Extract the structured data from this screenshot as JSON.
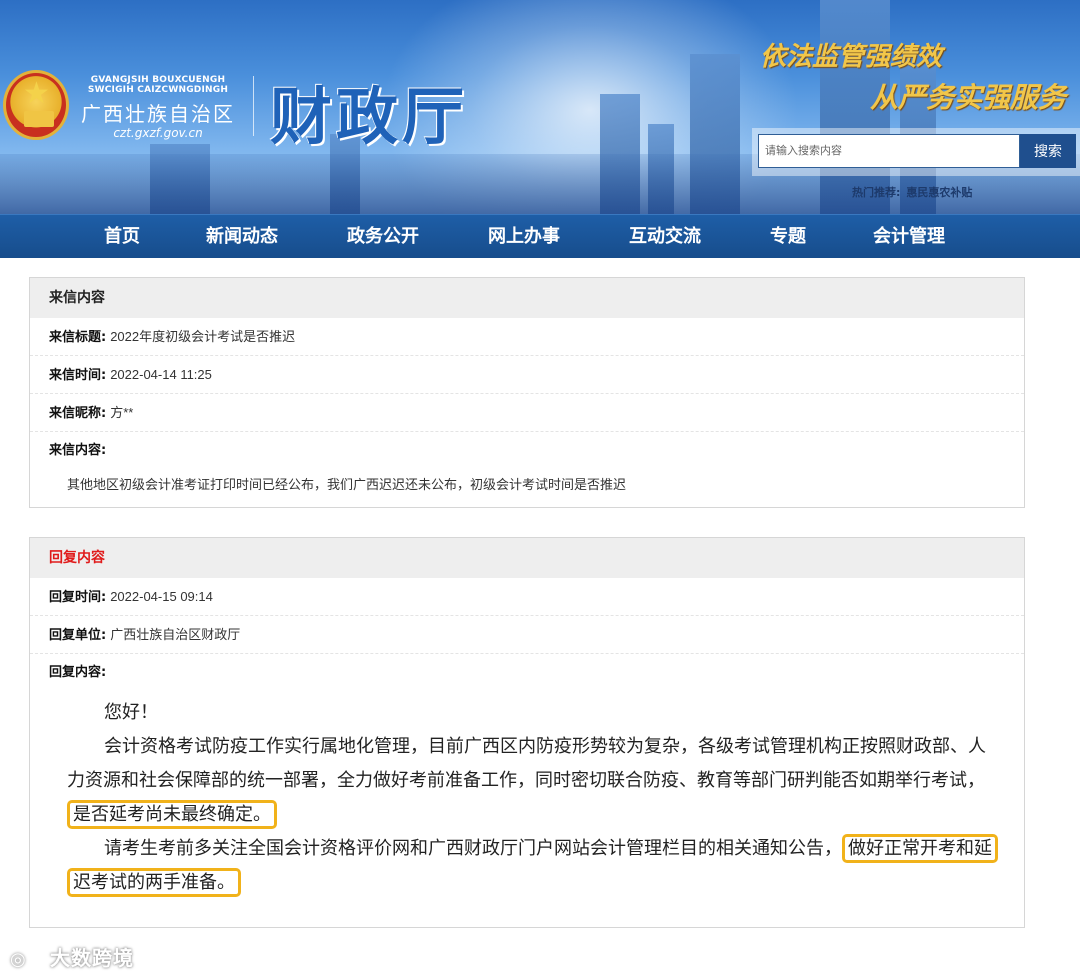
{
  "header": {
    "org_latin": "GVANGJSIH BOUXCUENGH SWCIGIH CAIZCWNGDINGH",
    "org_name": "广西壮族自治区",
    "org_domain": "czt.gxzf.gov.cn",
    "site_title": "财政厅",
    "slogan_1": "依法监管强绩效",
    "slogan_2": "从严务实强服务",
    "search_placeholder": "请输入搜索内容",
    "search_button": "搜索",
    "hot_label": "热门推荐:",
    "hot_link": "惠民惠农补贴"
  },
  "nav": [
    "首页",
    "新闻动态",
    "政务公开",
    "网上办事",
    "互动交流",
    "专题",
    "会计管理"
  ],
  "letter": {
    "section_title": "来信内容",
    "title_label": "来信标题:",
    "title_value": "2022年度初级会计考试是否推迟",
    "time_label": "来信时间:",
    "time_value": "2022-04-14 11:25",
    "nick_label": "来信昵称:",
    "nick_value": "方**",
    "content_label": "来信内容:",
    "content_value": "其他地区初级会计准考证打印时间已经公布，我们广西迟迟还未公布，初级会计考试时间是否推迟"
  },
  "reply": {
    "section_title": "回复内容",
    "time_label": "回复时间:",
    "time_value": "2022-04-15 09:14",
    "unit_label": "回复单位:",
    "unit_value": "广西壮族自治区财政厅",
    "content_label": "回复内容:",
    "greeting": "您好！",
    "para1_text": "会计资格考试防疫工作实行属地化管理，目前广西区内防疫形势较为复杂，各级考试管理机构正按照财政部、人力资源和社会保障部的统一部署，全力做好考前准备工作，同时密切联合防疫、教育等部门研判能否如期举行考试，",
    "para1_highlight": "是否延考尚未最终确定。",
    "para2_text": "请考生考前多关注全国会计资格评价网和广西财政厅门户网站会计管理栏目的相关通知公告，",
    "para2_highlight": "做好正常开考和延迟考试的两手准备。"
  },
  "watermark": "大数跨境"
}
